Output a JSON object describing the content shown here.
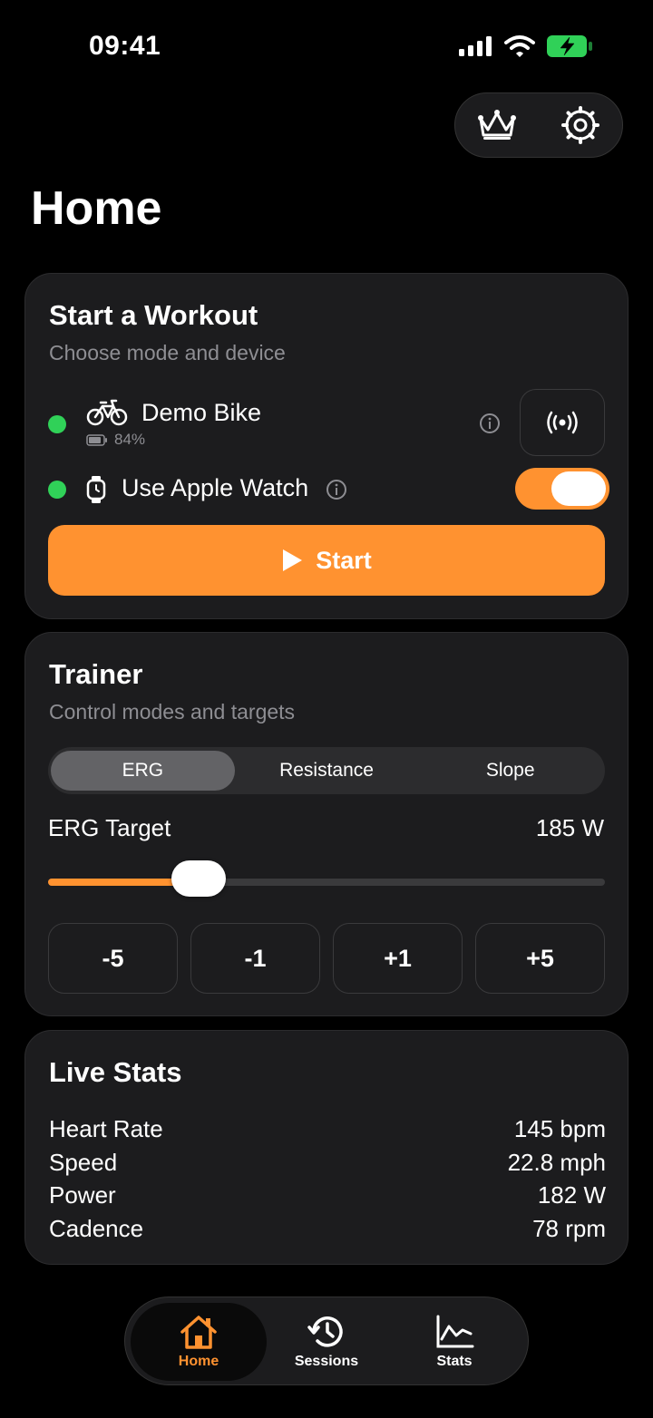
{
  "status": {
    "time": "09:41"
  },
  "page": {
    "title": "Home"
  },
  "workout": {
    "title": "Start a Workout",
    "subtitle": "Choose mode and device",
    "device_name": "Demo Bike",
    "device_battery": "84%",
    "watch_label": "Use Apple Watch",
    "watch_enabled": true,
    "start_label": "Start"
  },
  "trainer": {
    "title": "Trainer",
    "subtitle": "Control modes and targets",
    "modes": [
      "ERG",
      "Resistance",
      "Slope"
    ],
    "selected_mode": "ERG",
    "target_label": "ERG Target",
    "target_value": "185 W",
    "slider_fraction": 0.27,
    "steps": [
      "-5",
      "-1",
      "+1",
      "+5"
    ]
  },
  "live_stats": {
    "title": "Live Stats",
    "rows": [
      {
        "label": "Heart Rate",
        "value": "145 bpm"
      },
      {
        "label": "Speed",
        "value": "22.8 mph"
      },
      {
        "label": "Power",
        "value": "182 W"
      },
      {
        "label": "Cadence",
        "value": "78 rpm"
      }
    ]
  },
  "tabs": [
    {
      "label": "Home",
      "icon": "house-icon",
      "active": true
    },
    {
      "label": "Sessions",
      "icon": "history-icon",
      "active": false
    },
    {
      "label": "Stats",
      "icon": "chart-icon",
      "active": false
    }
  ],
  "colors": {
    "accent": "#ff9230",
    "online": "#30d158",
    "card": "#1c1c1e"
  }
}
